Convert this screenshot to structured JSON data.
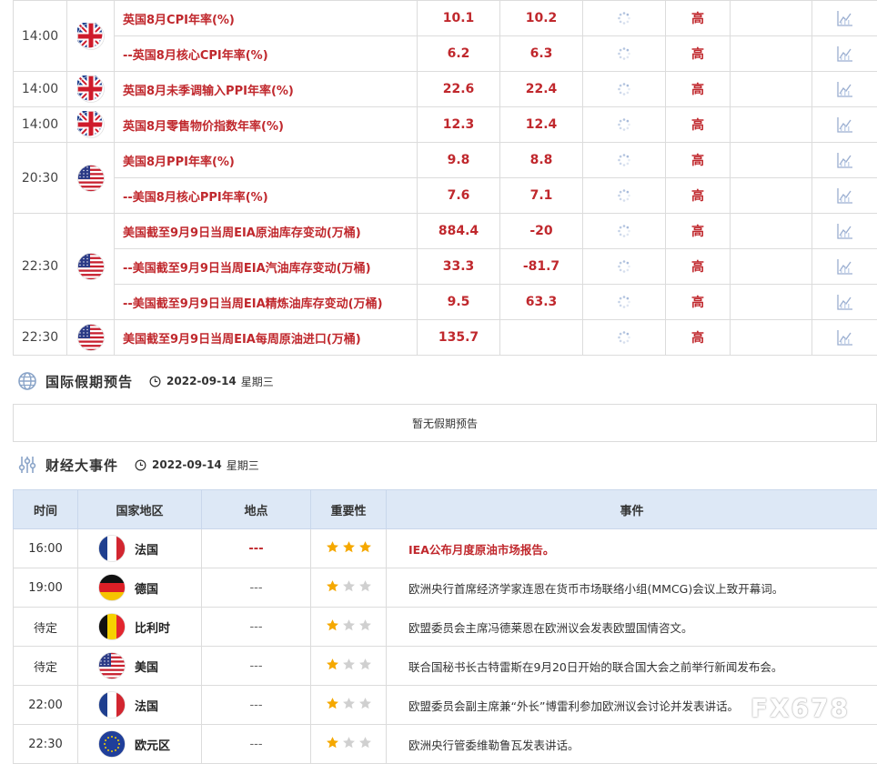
{
  "data_table": {
    "groups": [
      {
        "time": "14:00",
        "country": "英国",
        "flag": "uk",
        "rows": [
          {
            "name": "英国8月CPI年率(%)",
            "prev": "10.1",
            "forecast": "10.2",
            "importance": "高"
          },
          {
            "name": "--英国8月核心CPI年率(%)",
            "prev": "6.2",
            "forecast": "6.3",
            "importance": "高"
          }
        ]
      },
      {
        "time": "14:00",
        "country": "英国",
        "flag": "uk",
        "rows": [
          {
            "name": "英国8月未季调输入PPI年率(%)",
            "prev": "22.6",
            "forecast": "22.4",
            "importance": "高"
          }
        ]
      },
      {
        "time": "14:00",
        "country": "英国",
        "flag": "uk",
        "rows": [
          {
            "name": "英国8月零售物价指数年率(%)",
            "prev": "12.3",
            "forecast": "12.4",
            "importance": "高"
          }
        ]
      },
      {
        "time": "20:30",
        "country": "美国",
        "flag": "us",
        "rows": [
          {
            "name": "美国8月PPI年率(%)",
            "prev": "9.8",
            "forecast": "8.8",
            "importance": "高"
          },
          {
            "name": "--美国8月核心PPI年率(%)",
            "prev": "7.6",
            "forecast": "7.1",
            "importance": "高"
          }
        ]
      },
      {
        "time": "22:30",
        "country": "美国",
        "flag": "us",
        "rows": [
          {
            "name": "美国截至9月9日当周EIA原油库存变动(万桶)",
            "prev": "884.4",
            "forecast": "-20",
            "importance": "高"
          },
          {
            "name": "--美国截至9月9日当周EIA汽油库存变动(万桶)",
            "prev": "33.3",
            "forecast": "-81.7",
            "importance": "高"
          },
          {
            "name": "--美国截至9月9日当周EIA精炼油库存变动(万桶)",
            "prev": "9.5",
            "forecast": "63.3",
            "importance": "高"
          }
        ]
      },
      {
        "time": "22:30",
        "country": "美国",
        "flag": "us",
        "rows": [
          {
            "name": "美国截至9月9日当周EIA每周原油进口(万桶)",
            "prev": "135.7",
            "forecast": "",
            "importance": "高"
          }
        ]
      }
    ],
    "icons": {
      "pending": "loading-spinner-icon",
      "chart": "line-chart-icon"
    }
  },
  "holiday": {
    "title": "国际假期预告",
    "date": "2022-09-14",
    "weekday": "星期三",
    "empty_text": "暂无假期预告",
    "icon": "globe-icon"
  },
  "events": {
    "title": "财经大事件",
    "date": "2022-09-14",
    "weekday": "星期三",
    "icon": "sliders-icon",
    "headers": [
      "时间",
      "国家地区",
      "地点",
      "重要性",
      "事件"
    ],
    "rows": [
      {
        "time": "16:00",
        "country": "法国",
        "flag": "fr",
        "place": "---",
        "stars": 3,
        "event": "IEA公布月度原油市场报告。",
        "hot": true
      },
      {
        "time": "19:00",
        "country": "德国",
        "flag": "de",
        "place": "---",
        "stars": 1,
        "event": "欧洲央行首席经济学家连恩在货币市场联络小组(MMCG)会议上致开幕词。",
        "hot": false
      },
      {
        "time": "待定",
        "country": "比利时",
        "flag": "be",
        "place": "---",
        "stars": 1,
        "event": "欧盟委员会主席冯德莱恩在欧洲议会发表欧盟国情咨文。",
        "hot": false
      },
      {
        "time": "待定",
        "country": "美国",
        "flag": "us",
        "place": "---",
        "stars": 1,
        "event": "联合国秘书长古特雷斯在9月20日开始的联合国大会之前举行新闻发布会。",
        "hot": false
      },
      {
        "time": "22:00",
        "country": "法国",
        "flag": "fr",
        "place": "---",
        "stars": 1,
        "event": "欧盟委员会副主席兼“外长”博雷利参加欧洲议会讨论并发表讲话。",
        "hot": false
      },
      {
        "time": "22:30",
        "country": "欧元区",
        "flag": "eu",
        "place": "---",
        "stars": 1,
        "event": "欧洲央行管委维勒鲁瓦发表讲话。",
        "hot": false
      }
    ]
  },
  "colors": {
    "accent_red": "#c0282d",
    "header_blue": "#dde8f6",
    "star_gold": "#f5a800",
    "star_gray": "#d0d0d0"
  },
  "watermark": "FX678"
}
